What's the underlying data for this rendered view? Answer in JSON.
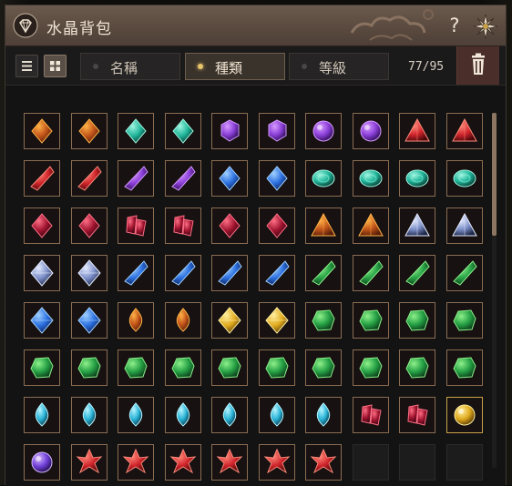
{
  "window": {
    "title": "水晶背包",
    "help_label": "?"
  },
  "colors": {
    "accent": "#e8c46a",
    "title_bar": "#5a4a3f",
    "slot_border": "#8a6d52"
  },
  "toolbar": {
    "view_modes": [
      {
        "name": "list-view",
        "icon": "list-icon",
        "active": false
      },
      {
        "name": "grid-view",
        "icon": "grid-icon",
        "active": true
      }
    ],
    "sort_tabs": [
      {
        "label": "名稱",
        "active": false
      },
      {
        "label": "種類",
        "active": true
      },
      {
        "label": "等級",
        "active": false
      }
    ],
    "capacity": "77/95"
  },
  "inventory": {
    "rows": [
      [
        "orange-flame-crystal",
        "orange-flame-crystal",
        "green-blue-gem",
        "green-blue-gem",
        "purple-hexagon-gem",
        "purple-hexagon-gem",
        "purple-round-gem",
        "purple-round-gem",
        "red-triangle-gem",
        "red-triangle-gem"
      ],
      [
        "red-shard",
        "red-shard",
        "purple-shard",
        "purple-shard",
        "blue-gem",
        "blue-gem",
        "teal-oval-gem",
        "teal-oval-gem",
        "teal-oval-gem",
        "teal-oval-gem"
      ],
      [
        "crimson-crystal",
        "crimson-crystal",
        "crimson-cluster",
        "crimson-cluster",
        "dark-red-crystal",
        "dark-red-crystal",
        "orange-black-pyramid",
        "orange-black-pyramid",
        "blue-black-pyramid",
        "blue-black-pyramid"
      ],
      [
        "silver-blue-octahedron",
        "silver-blue-octahedron",
        "blue-spike-crystal",
        "blue-spike-crystal",
        "blue-spike-crystal",
        "blue-spike-crystal",
        "green-spike-crystal",
        "green-spike-crystal",
        "green-spike-crystal",
        "green-spike-crystal"
      ],
      [
        "dark-blue-octahedron",
        "dark-blue-octahedron",
        "orange-teardrop-gem",
        "orange-teardrop-gem",
        "gold-black-octahedron",
        "gold-black-octahedron",
        "green-rough-gem",
        "green-rough-gem",
        "green-rough-gem",
        "green-rough-gem"
      ],
      [
        "green-rough-gem",
        "green-rough-gem",
        "green-rough-gem",
        "green-rough-gem",
        "green-rough-gem",
        "green-rough-gem",
        "green-rough-gem",
        "green-rough-gem",
        "green-rough-gem",
        "green-rough-gem"
      ],
      [
        "cyan-teardrop-gem",
        "cyan-teardrop-gem",
        "cyan-teardrop-gem",
        "cyan-teardrop-gem",
        "cyan-teardrop-gem",
        "cyan-teardrop-gem",
        "cyan-teardrop-gem",
        "dark-ruby-cluster",
        "dark-ruby-cluster",
        "gold-orb"
      ],
      [
        "violet-orb",
        "red-star-crystal",
        "red-star-crystal",
        "red-star-crystal",
        "red-star-crystal",
        "red-star-crystal",
        "red-star-crystal",
        "",
        "",
        ""
      ]
    ]
  }
}
